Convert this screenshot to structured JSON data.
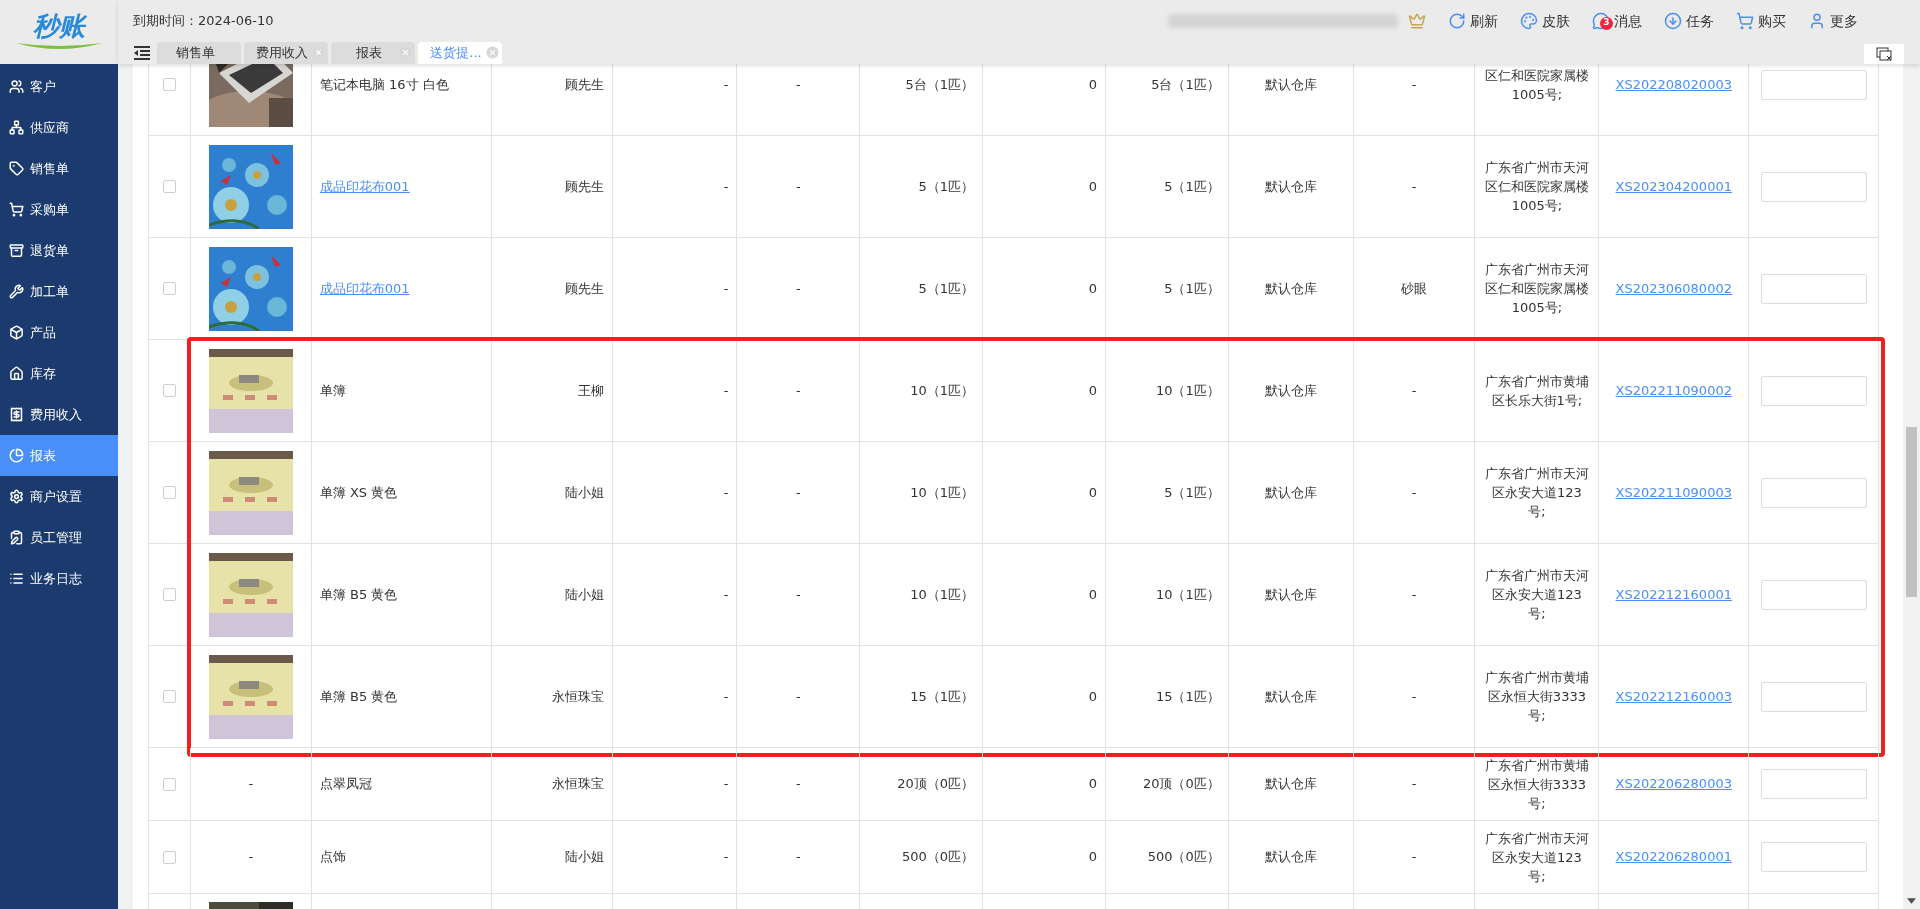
{
  "logo": {
    "text": "秒账"
  },
  "expiry": "到期时间：2024-06-10",
  "toolbar": [
    {
      "kind": "refresh",
      "label": "刷新"
    },
    {
      "kind": "skin",
      "label": "皮肤"
    },
    {
      "kind": "message",
      "label": "消息",
      "badge": "3"
    },
    {
      "kind": "task",
      "label": "任务"
    },
    {
      "kind": "buy",
      "label": "购买"
    },
    {
      "kind": "more",
      "label": "更多"
    }
  ],
  "tabs": [
    {
      "label": "销售单",
      "selected": false,
      "closable": false
    },
    {
      "label": "费用收入",
      "selected": false,
      "closable": true
    },
    {
      "label": "报表",
      "selected": false,
      "closable": true
    },
    {
      "label": "送货提...",
      "selected": true,
      "closable": true
    }
  ],
  "sidebar": {
    "items": [
      {
        "kind": "customer",
        "label": "客户",
        "selected": false
      },
      {
        "kind": "supplier",
        "label": "供应商",
        "selected": false
      },
      {
        "kind": "sales",
        "label": "销售单",
        "selected": false
      },
      {
        "kind": "purchase",
        "label": "采购单",
        "selected": false
      },
      {
        "kind": "return",
        "label": "退货单",
        "selected": false
      },
      {
        "kind": "process",
        "label": "加工单",
        "selected": false
      },
      {
        "kind": "product",
        "label": "产品",
        "selected": false
      },
      {
        "kind": "stock",
        "label": "库存",
        "selected": false
      },
      {
        "kind": "expense",
        "label": "费用收入",
        "selected": false
      },
      {
        "kind": "report",
        "label": "报表",
        "selected": true
      },
      {
        "kind": "settings",
        "label": "商户设置",
        "selected": false
      },
      {
        "kind": "staff",
        "label": "员工管理",
        "selected": false
      },
      {
        "kind": "log",
        "label": "业务日志",
        "selected": false
      }
    ]
  },
  "table": {
    "rows": [
      {
        "checked": false,
        "highlighted": false,
        "name": "笔记本电脑 16寸 白色",
        "name_link": false,
        "customer": "顾先生",
        "column_5": "-",
        "column_6": "-",
        "quantity": "5台（1匹）",
        "column_8": "0",
        "column_9": "5台（1匹）",
        "warehouse": "默认仓库",
        "remark": "-",
        "address": "区仁和医院家属楼1005号;",
        "order": "XS202208020003"
      },
      {
        "checked": false,
        "highlighted": false,
        "name": "成品印花布001",
        "name_link": true,
        "customer": "顾先生",
        "column_5": "-",
        "column_6": "-",
        "quantity": "5（1匹）",
        "column_8": "0",
        "column_9": "5（1匹）",
        "warehouse": "默认仓库",
        "remark": "-",
        "address": "广东省广州市天河区仁和医院家属楼1005号;",
        "order": "XS202304200001"
      },
      {
        "checked": false,
        "highlighted": false,
        "name": "成品印花布001",
        "name_link": true,
        "customer": "顾先生",
        "column_5": "-",
        "column_6": "-",
        "quantity": "5（1匹）",
        "column_8": "0",
        "column_9": "5（1匹）",
        "warehouse": "默认仓库",
        "remark": "砂眼",
        "address": "广东省广州市天河区仁和医院家属楼1005号;",
        "order": "XS202306080002"
      },
      {
        "checked": false,
        "highlighted": true,
        "name": "单簿",
        "name_link": false,
        "customer": "王柳",
        "column_5": "-",
        "column_6": "-",
        "quantity": "10（1匹）",
        "column_8": "0",
        "column_9": "10（1匹）",
        "warehouse": "默认仓库",
        "remark": "-",
        "address": "广东省广州市黄埔区长乐大街1号;",
        "order": "XS202211090002"
      },
      {
        "checked": false,
        "highlighted": true,
        "name": "单簿 XS 黄色",
        "name_link": false,
        "customer": "陆小姐",
        "column_5": "-",
        "column_6": "-",
        "quantity": "10（1匹）",
        "column_8": "0",
        "column_9": "5（1匹）",
        "warehouse": "默认仓库",
        "remark": "-",
        "address": "广东省广州市天河区永安大道123号;",
        "order": "XS202211090003"
      },
      {
        "checked": false,
        "highlighted": true,
        "name": "单簿 B5 黄色",
        "name_link": false,
        "customer": "陆小姐",
        "column_5": "-",
        "column_6": "-",
        "quantity": "10（1匹）",
        "column_8": "0",
        "column_9": "10（1匹）",
        "warehouse": "默认仓库",
        "remark": "-",
        "address": "广东省广州市天河区永安大道123号;",
        "order": "XS202212160001"
      },
      {
        "checked": false,
        "highlighted": true,
        "name": "单簿 B5 黄色",
        "name_link": false,
        "customer": "永恒珠宝",
        "column_5": "-",
        "column_6": "-",
        "quantity": "15（1匹）",
        "column_8": "0",
        "column_9": "15（1匹）",
        "warehouse": "默认仓库",
        "remark": "-",
        "address": "广东省广州市黄埔区永恒大街3333号;",
        "order": "XS202212160003"
      },
      {
        "checked": false,
        "highlighted": false,
        "image_text": "-",
        "name": "点翠凤冠",
        "name_link": false,
        "customer": "永恒珠宝",
        "column_5": "-",
        "column_6": "-",
        "quantity": "20顶（0匹）",
        "column_8": "0",
        "column_9": "20顶（0匹）",
        "warehouse": "默认仓库",
        "remark": "-",
        "address": "广东省广州市黄埔区永恒大街3333号;",
        "order": "XS202206280003"
      },
      {
        "checked": false,
        "highlighted": false,
        "image_text": "-",
        "name": "点饰",
        "name_link": false,
        "customer": "陆小姐",
        "column_5": "-",
        "column_6": "-",
        "quantity": "500（0匹）",
        "column_8": "0",
        "column_9": "500（0匹）",
        "warehouse": "默认仓库",
        "remark": "-",
        "address": "广东省广州市天河区永安大道123号;",
        "order": "XS202206280001"
      },
      {
        "highlighted": false
      }
    ]
  }
}
